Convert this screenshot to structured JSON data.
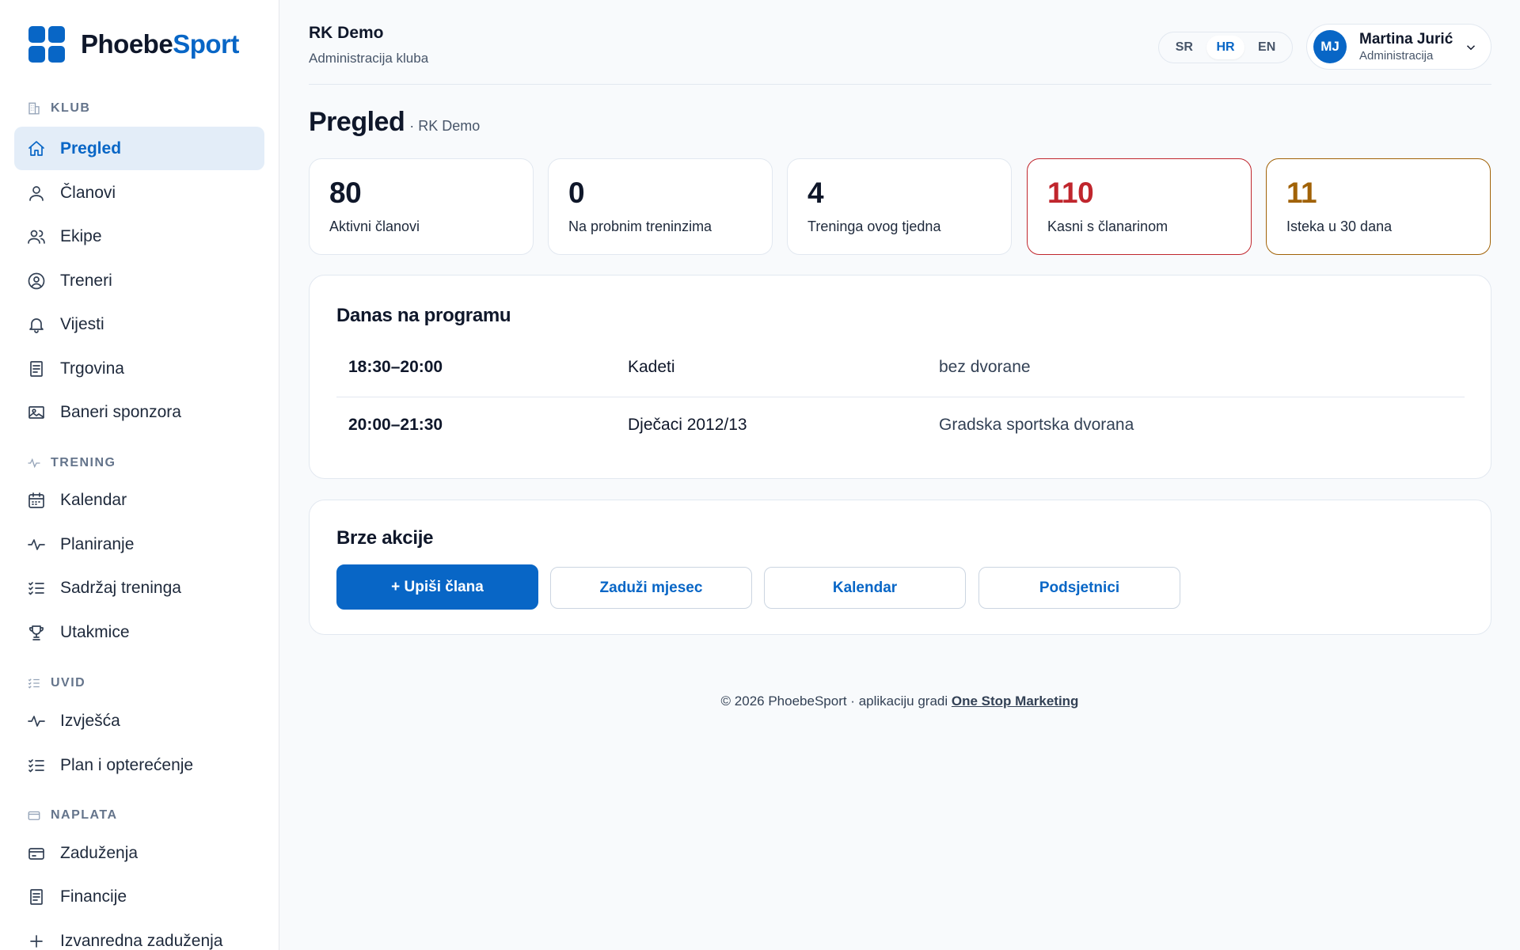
{
  "brand": {
    "name_part1": "Phoebe",
    "name_part2": "Sport",
    "accent_color": "#0866c6"
  },
  "sidebar": {
    "sections": [
      {
        "label": "KLUB",
        "icon": "building-icon"
      },
      {
        "label": "TRENING",
        "icon": "activity-icon"
      },
      {
        "label": "UVID",
        "icon": "list-check-icon"
      },
      {
        "label": "NAPLATA",
        "icon": "credit-card-icon"
      }
    ],
    "items": [
      {
        "label": "Pregled",
        "icon": "home-icon",
        "active": true
      },
      {
        "label": "Članovi",
        "icon": "user-icon"
      },
      {
        "label": "Ekipe",
        "icon": "users-icon"
      },
      {
        "label": "Treneri",
        "icon": "user-circle-icon"
      },
      {
        "label": "Vijesti",
        "icon": "bell-icon"
      },
      {
        "label": "Trgovina",
        "icon": "receipt-icon"
      },
      {
        "label": "Baneri sponzora",
        "icon": "image-icon"
      },
      {
        "label": "Kalendar",
        "icon": "calendar-icon"
      },
      {
        "label": "Planiranje",
        "icon": "activity-icon"
      },
      {
        "label": "Sadržaj treninga",
        "icon": "list-check-icon"
      },
      {
        "label": "Utakmice",
        "icon": "trophy-icon"
      },
      {
        "label": "Izvješća",
        "icon": "activity-icon"
      },
      {
        "label": "Plan i opterećenje",
        "icon": "list-check-icon"
      },
      {
        "label": "Zaduženja",
        "icon": "credit-card-icon"
      },
      {
        "label": "Financije",
        "icon": "receipt-icon"
      },
      {
        "label": "Izvanredna zaduženja",
        "icon": "plus-icon"
      }
    ]
  },
  "header": {
    "club_name": "RK Demo",
    "club_subtitle": "Administracija kluba",
    "languages": [
      "SR",
      "HR",
      "EN"
    ],
    "active_language": "HR",
    "user": {
      "initials": "MJ",
      "name": "Martina Jurić",
      "role": "Administracija"
    }
  },
  "page": {
    "title": "Pregled",
    "subtitle": "· RK Demo"
  },
  "stats": [
    {
      "value": "80",
      "label": "Aktivni članovi",
      "tone": "default"
    },
    {
      "value": "0",
      "label": "Na probnim treninzima",
      "tone": "default"
    },
    {
      "value": "4",
      "label": "Treninga ovog tjedna",
      "tone": "default"
    },
    {
      "value": "110",
      "label": "Kasni s članarinom",
      "tone": "danger",
      "color": "#c0262d"
    },
    {
      "value": "11",
      "label": "Isteka u 30 dana",
      "tone": "warning",
      "color": "#a16207"
    }
  ],
  "today": {
    "title": "Danas na programu",
    "rows": [
      {
        "time": "18:30–20:00",
        "team": "Kadeti",
        "hall": "bez dvorane"
      },
      {
        "time": "20:00–21:30",
        "team": "Dječaci 2012/13",
        "hall": "Gradska sportska dvorana"
      }
    ]
  },
  "quick_actions": {
    "title": "Brze akcije",
    "buttons": [
      "+ Upiši člana",
      "Zaduži mjesec",
      "Kalendar",
      "Podsjetnici"
    ]
  },
  "footer": {
    "text": "© 2026 PhoebeSport · aplikaciju gradi ",
    "link": "One Stop Marketing"
  }
}
